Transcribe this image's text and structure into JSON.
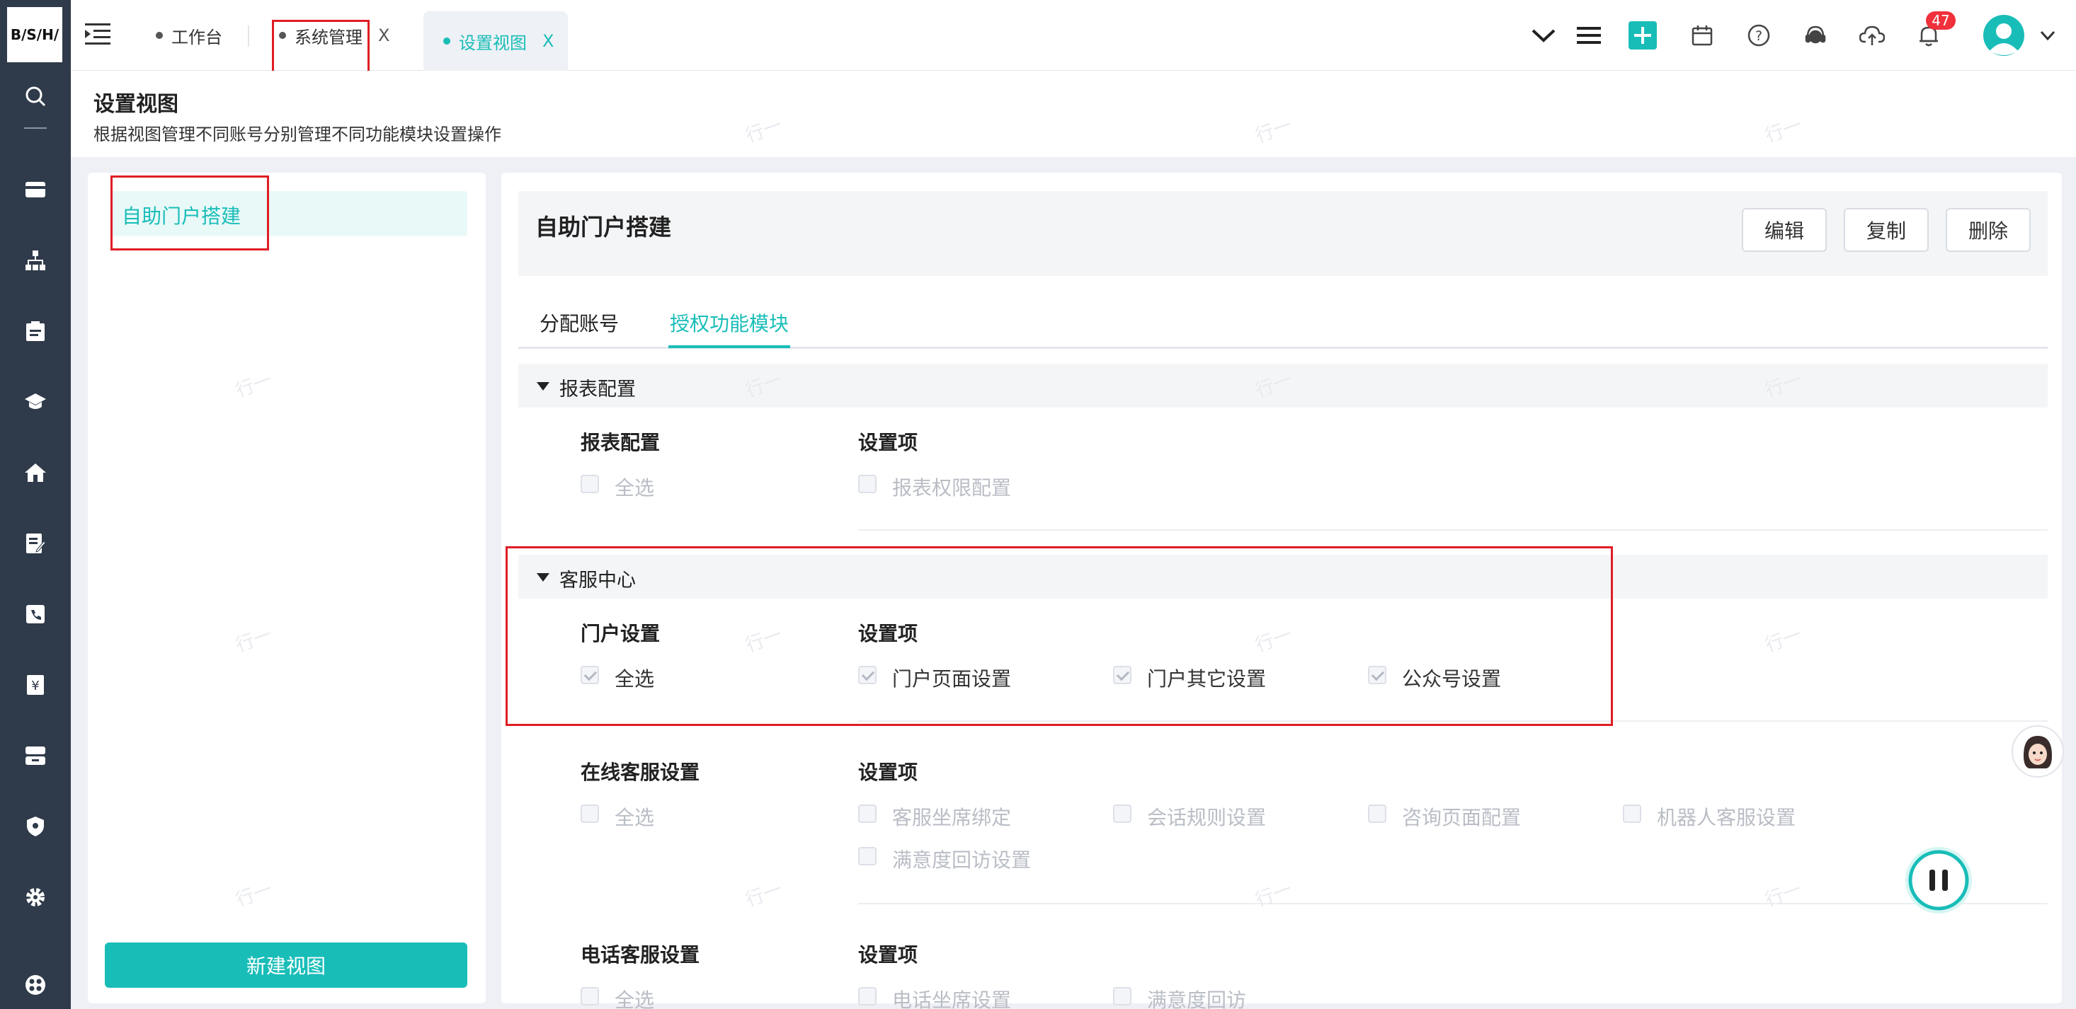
{
  "logo": {
    "text": "B/S/H/"
  },
  "tabs": [
    {
      "label": "工作台",
      "active": false,
      "closable": false
    },
    {
      "label": "系统管理",
      "active": false,
      "closable": true
    },
    {
      "label": "设置视图",
      "active": true,
      "closable": true
    }
  ],
  "tab_close_symbol": "X",
  "notification_count": "47",
  "header": {
    "title": "设置视图",
    "subtitle": "根据视图管理不同账号分别管理不同功能模块设置操作"
  },
  "watermark": "行一",
  "left_panel": {
    "selected_view": "自助门户搭建",
    "new_view_button": "新建视图"
  },
  "detail": {
    "title": "自助门户搭建",
    "actions": {
      "edit": "编辑",
      "copy": "复制",
      "delete": "删除"
    },
    "tabs": [
      {
        "label": "分配账号",
        "active": false
      },
      {
        "label": "授权功能模块",
        "active": true
      }
    ],
    "sections": [
      {
        "title": "报表配置",
        "groups": [
          {
            "name": "报表配置",
            "items_header": "设置项",
            "select_all": "全选",
            "items": [
              "报表权限配置"
            ],
            "checked": false
          }
        ]
      },
      {
        "title": "客服中心",
        "groups": [
          {
            "name": "门户设置",
            "items_header": "设置项",
            "select_all": "全选",
            "items": [
              "门户页面设置",
              "门户其它设置",
              "公众号设置"
            ],
            "checked": true
          },
          {
            "name": "在线客服设置",
            "items_header": "设置项",
            "select_all": "全选",
            "items": [
              "客服坐席绑定",
              "会话规则设置",
              "咨询页面配置",
              "机器人客服设置",
              "满意度回访设置"
            ],
            "checked": false
          },
          {
            "name": "电话客服设置",
            "items_header": "设置项",
            "select_all": "全选",
            "items": [
              "电话坐席设置",
              "满意度回访"
            ],
            "checked": false
          }
        ]
      }
    ]
  },
  "colors": {
    "accent": "#19bdb8",
    "sidebar": "#2f3a4a",
    "highlight_box": "#e01d24",
    "badge": "#f0303a"
  },
  "sidebar_icons": [
    "search-icon",
    "card-icon",
    "org-chart-icon",
    "clipboard-icon",
    "graduation-cap-icon",
    "home-icon",
    "edit-note-icon",
    "phone-card-icon",
    "yen-icon",
    "storage-icon",
    "shield-icon",
    "gear-icon",
    "apps-icon"
  ],
  "topbar_icons": [
    "collapse-menu-icon",
    "chevron-down-icon",
    "list-icon",
    "add-icon",
    "calendar-icon",
    "help-icon",
    "support-agent-icon",
    "cloud-upload-icon",
    "bell-icon",
    "user-avatar"
  ]
}
